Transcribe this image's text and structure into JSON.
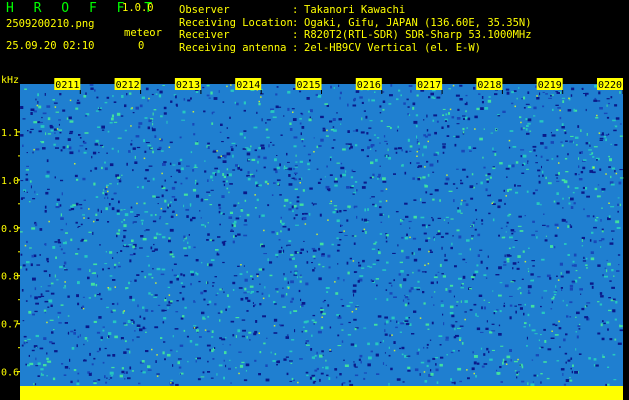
{
  "app": {
    "title": "H R O F F T",
    "version": "1.0.0",
    "filename": "2509200210.png",
    "datetime": "25.09.20 02:10",
    "meteor_label": "meteor",
    "meteor_count": "0"
  },
  "station": [
    {
      "key": "Observer",
      "value": "Takanori Kawachi"
    },
    {
      "key": "Receiving Location",
      "value": "Ogaki, Gifu, JAPAN (136.60E, 35.35N)"
    },
    {
      "key": "Receiver",
      "value": "R820T2(RTL-SDR) SDR-Sharp 53.1000MHz"
    },
    {
      "key": "Receiving antenna",
      "value": "2el-HB9CV Vertical (el. E-W)"
    }
  ],
  "spectrogram": {
    "y_unit": "kHz",
    "y_ticks": [
      "1.1",
      "1.0",
      "0.9",
      "0.8",
      "0.7",
      "0.6"
    ],
    "y_values": [
      1.1,
      1.0,
      0.9,
      0.8,
      0.7,
      0.6
    ],
    "y_range": [
      0.57,
      1.2
    ],
    "minute_labels": [
      "0211",
      "0212",
      "0213",
      "0214",
      "0215",
      "0216",
      "0217",
      "0218",
      "0219",
      "0220"
    ],
    "colors": {
      "background": "#000000",
      "text": "#ffff00",
      "noise_dark": "#0a1a8a",
      "noise_mid": "#1f7fd0",
      "noise_light": "#26c8c0",
      "carrier": "#ffff00"
    }
  }
}
